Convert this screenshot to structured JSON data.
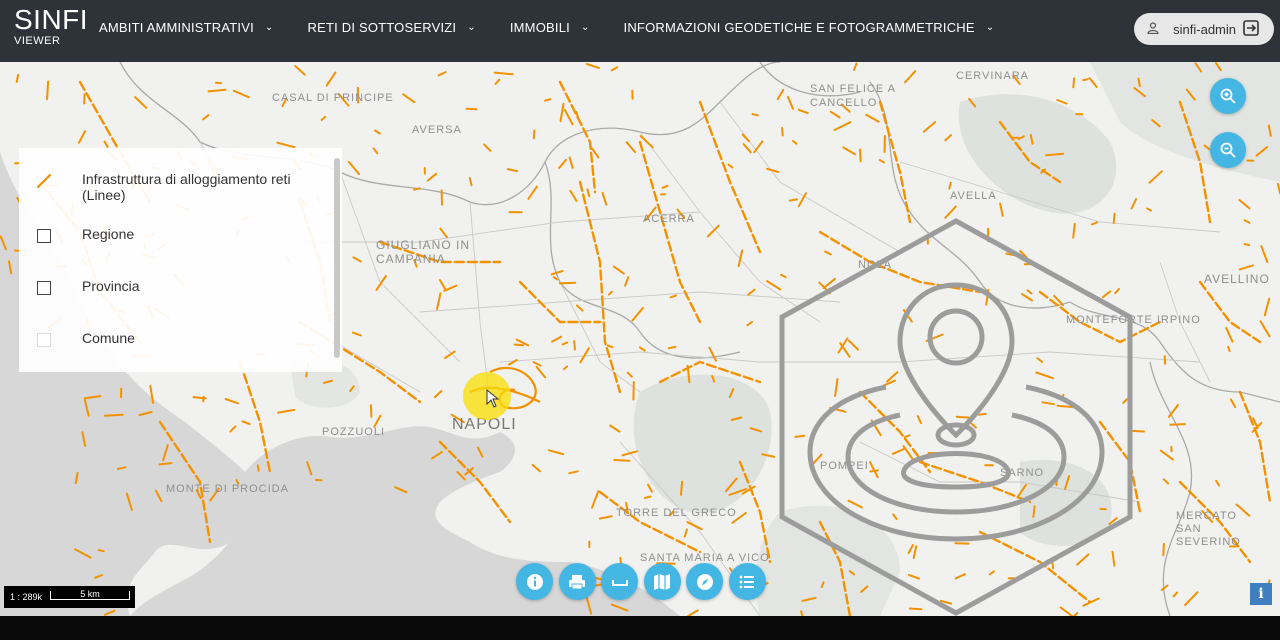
{
  "app": {
    "title": "SINFI",
    "subtitle": "VIEWER"
  },
  "nav": {
    "items": [
      {
        "label": "AMBITI AMMINISTRATIVI"
      },
      {
        "label": "RETI DI SOTTOSERVIZI"
      },
      {
        "label": "IMMOBILI"
      },
      {
        "label": "INFORMAZIONI GEODETICHE E FOTOGRAMMETRICHE"
      }
    ]
  },
  "user": {
    "name": "sinfi-admin",
    "icon": "user-icon",
    "logout_icon": "logout-icon"
  },
  "legend": {
    "items": [
      {
        "label": "Infrastruttura di alloggiamento reti (Linee)",
        "symbol": "orange-line",
        "color": "#f39200"
      },
      {
        "label": "Regione",
        "symbol": "checkbox"
      },
      {
        "label": "Provincia",
        "symbol": "checkbox"
      },
      {
        "label": "Comune",
        "symbol": "checkbox"
      }
    ]
  },
  "map": {
    "labels": [
      "CASAL DI PRINCIPE",
      "AVERSA",
      "GIUGLIANO IN CAMPANIA",
      "ACERRA",
      "NOLA",
      "AVELLA",
      "AVELLINO",
      "MONTEFORTE IRPINO",
      "NAPOLI",
      "POZZUOLI",
      "MONTE DI PROCIDA",
      "TORRE DEL GRECO",
      "SANTA MARIA A VICO",
      "SAN FELICE A CANCELLO",
      "CERVINARA",
      "MERCATO SAN SEVERINO",
      "SARNO",
      "POMPEI"
    ],
    "network_color": "#f39200"
  },
  "scale": {
    "ratio": "1 : 289k",
    "distance": "5 km"
  },
  "buttons": {
    "zoom_in": "zoom-in",
    "zoom_out": "zoom-out",
    "toolbar": [
      "info-icon",
      "print-icon",
      "measure-icon",
      "map-icon",
      "compass-icon",
      "list-icon"
    ]
  },
  "info": "i",
  "colors": {
    "topbar": "#2d3338",
    "accent": "#44b6e4",
    "network": "#f39200"
  }
}
